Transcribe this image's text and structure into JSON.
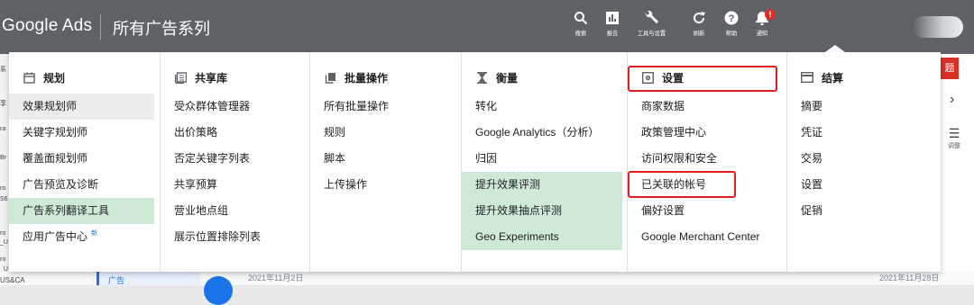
{
  "topbar": {
    "brand": "Google Ads",
    "title": "所有广告系列",
    "actions": [
      {
        "label": "搜索",
        "icon": "search-icon"
      },
      {
        "label": "报告",
        "icon": "report-icon"
      },
      {
        "label": "工具与设置",
        "icon": "wrench-icon"
      },
      {
        "label": "刷新",
        "icon": "refresh-icon"
      },
      {
        "label": "帮助",
        "icon": "help-icon"
      },
      {
        "label": "通知",
        "icon": "bell-icon",
        "badge": "!"
      }
    ]
  },
  "menu": {
    "columns": [
      {
        "title": "规划",
        "icon": "calendar-icon",
        "items": [
          {
            "label": "效果规划师"
          },
          {
            "label": "关键字规划师"
          },
          {
            "label": "覆盖面规划师"
          },
          {
            "label": "广告预览及诊断"
          },
          {
            "label": "广告系列翻译工具"
          },
          {
            "label": "应用广告中心",
            "badge": "新"
          }
        ]
      },
      {
        "title": "共享库",
        "icon": "library-icon",
        "items": [
          {
            "label": "受众群体管理器"
          },
          {
            "label": "出价策略"
          },
          {
            "label": "否定关键字列表"
          },
          {
            "label": "共享预算"
          },
          {
            "label": "营业地点组"
          },
          {
            "label": "展示位置排除列表"
          }
        ]
      },
      {
        "title": "批量操作",
        "icon": "copy-icon",
        "items": [
          {
            "label": "所有批量操作"
          },
          {
            "label": "规则"
          },
          {
            "label": "脚本"
          },
          {
            "label": "上传操作"
          }
        ]
      },
      {
        "title": "衡量",
        "icon": "hourglass-icon",
        "items": [
          {
            "label": "转化"
          },
          {
            "label": "Google Analytics（分析）"
          },
          {
            "label": "归因"
          },
          {
            "label": "提升效果评测"
          },
          {
            "label": "提升效果抽点评测"
          },
          {
            "label": "Geo Experiments"
          }
        ]
      },
      {
        "title": "设置",
        "icon": "settings-icon",
        "items": [
          {
            "label": "商家数据"
          },
          {
            "label": "政策管理中心"
          },
          {
            "label": "访问权限和安全"
          },
          {
            "label": "已关联的帐号"
          },
          {
            "label": "偏好设置"
          },
          {
            "label": "Google Merchant Center"
          }
        ]
      },
      {
        "title": "结算",
        "icon": "card-icon",
        "items": [
          {
            "label": "摘要"
          },
          {
            "label": "凭证"
          },
          {
            "label": "交易"
          },
          {
            "label": "设置"
          },
          {
            "label": "促销"
          }
        ]
      }
    ]
  },
  "background": {
    "date_left": "2021年11月2日",
    "date_right": "2021年11月28日",
    "nav_item": "广告",
    "region": "US&CA",
    "right_button": "题",
    "right_chevron": "›",
    "right_label": "调整"
  },
  "colors": {
    "topbar": "#5f6368",
    "highlight_green": "#ceead6",
    "highlight_grey": "#ededed",
    "annotation_red": "#e21d1d",
    "new_badge": "#1a73e8"
  }
}
